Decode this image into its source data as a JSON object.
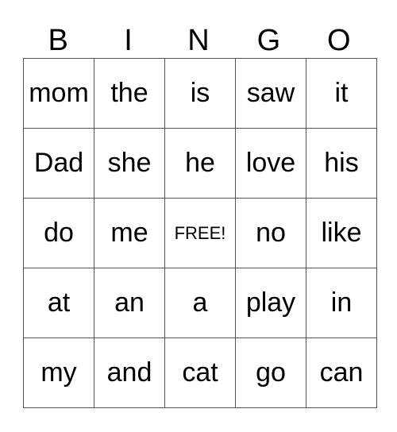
{
  "header": [
    "B",
    "I",
    "N",
    "G",
    "O"
  ],
  "rows": [
    [
      "mom",
      "the",
      "is",
      "saw",
      "it"
    ],
    [
      "Dad",
      "she",
      "he",
      "love",
      "his"
    ],
    [
      "do",
      "me",
      "FREE!",
      "no",
      "like"
    ],
    [
      "at",
      "an",
      "a",
      "play",
      "in"
    ],
    [
      "my",
      "and",
      "cat",
      "go",
      "can"
    ]
  ],
  "free_cell": {
    "row": 2,
    "col": 2
  }
}
